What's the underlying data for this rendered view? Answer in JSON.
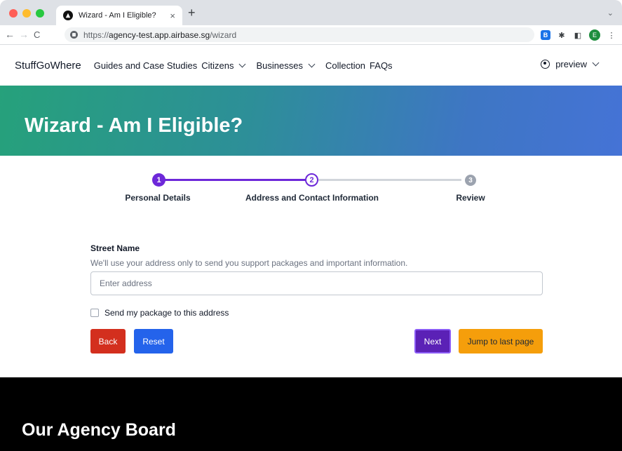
{
  "browser": {
    "tab_title": "Wizard - Am I Eligible?",
    "tab_close": "×",
    "new_tab": "+",
    "tab_menu": "⌄",
    "url_scheme": "https://",
    "url_host": "agency-test.app.airbase.sg",
    "url_path": "/wizard",
    "avatar_letter": "E",
    "nav_back": "←",
    "nav_forward": "→",
    "nav_reload": "C"
  },
  "sitenav": {
    "brand": "StuffGoWhere",
    "links": [
      "Guides and Case Studies",
      "Citizens",
      "Businesses",
      "Collection",
      "FAQs"
    ],
    "user": "preview"
  },
  "hero": {
    "title": "Wizard - Am I Eligible?"
  },
  "stepper": {
    "steps": [
      {
        "number": "1",
        "label": "Personal Details",
        "state": "completed"
      },
      {
        "number": "2",
        "label": "Address and Contact Information",
        "state": "current"
      },
      {
        "number": "3",
        "label": "Review",
        "state": "upcoming"
      }
    ]
  },
  "form": {
    "street_label": "Street Name",
    "street_help": "We'll use your address only to send you support packages and important information.",
    "street_placeholder": "Enter address",
    "street_value": "",
    "send_package_label": "Send my package to this address",
    "send_package_checked": false
  },
  "buttons": {
    "back": "Back",
    "reset": "Reset",
    "next": "Next",
    "jump": "Jump to last page"
  },
  "footer": {
    "title": "Our Agency Board"
  },
  "colors": {
    "primary_purple": "#6d28d9",
    "back_red": "#d32f1e",
    "reset_blue": "#2463eb",
    "jump_orange": "#f59e0b"
  }
}
